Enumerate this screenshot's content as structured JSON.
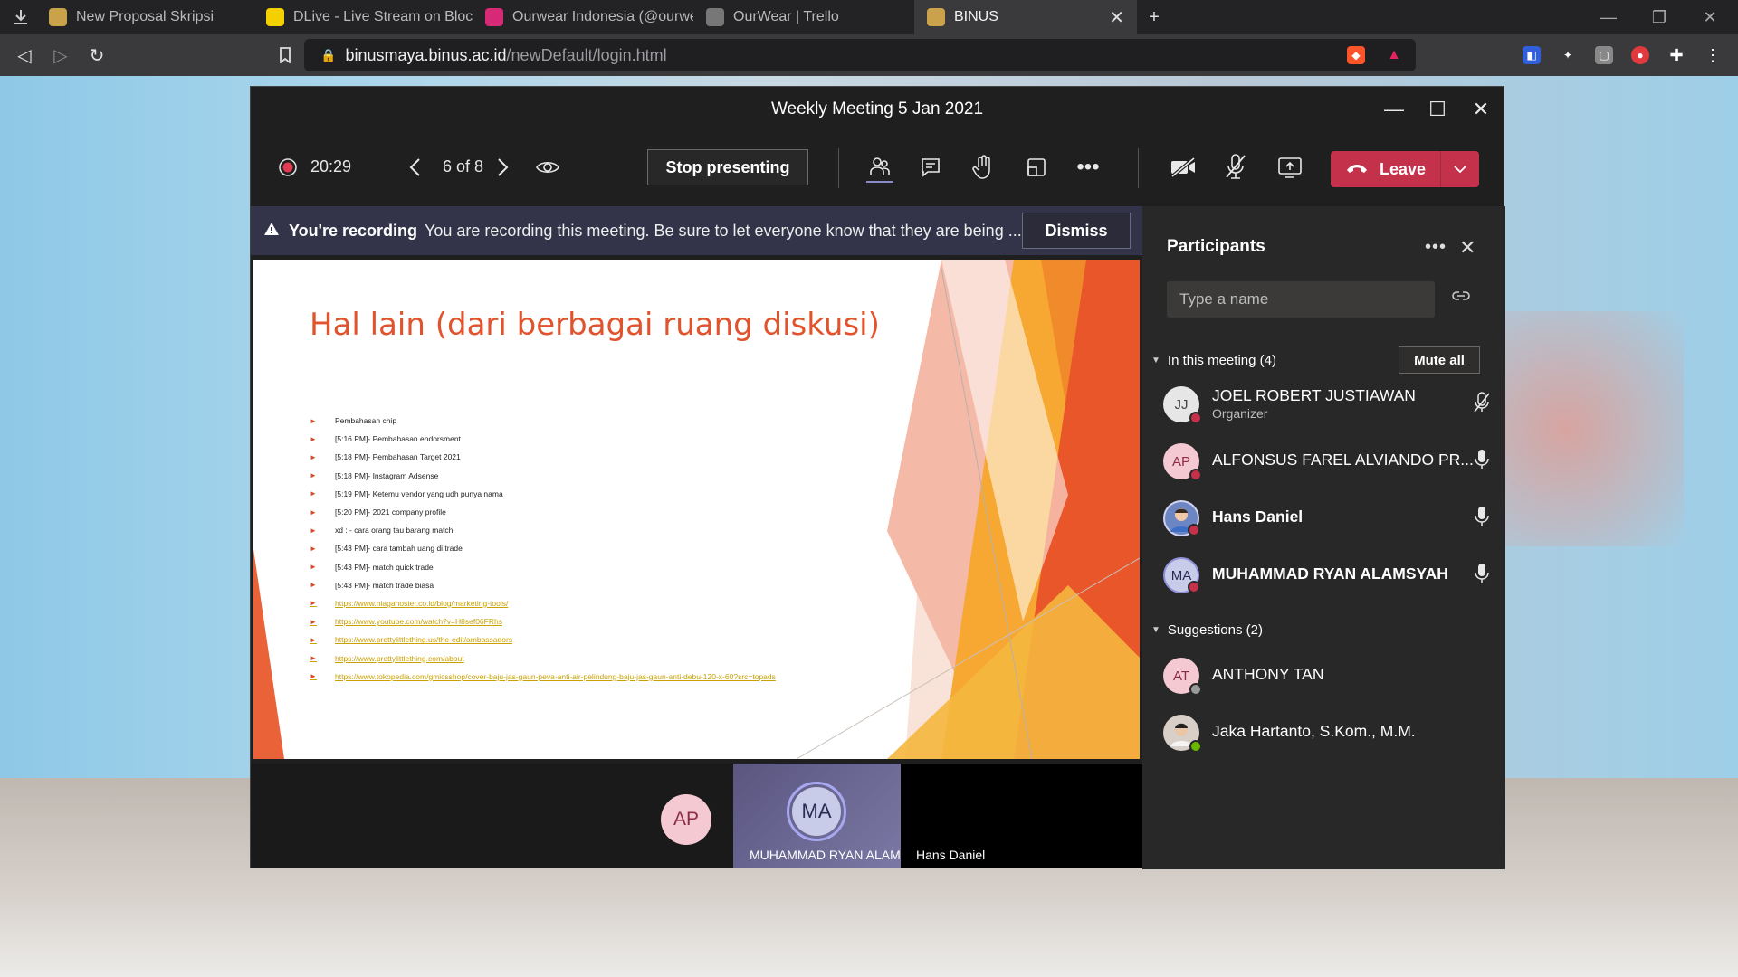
{
  "browser": {
    "tabs": [
      {
        "title": "New Proposal Skripsi",
        "color": "#c9a24b"
      },
      {
        "title": "DLive - Live Stream on Blockchain",
        "color": "#f5d000"
      },
      {
        "title": "Ourwear Indonesia (@ourwear_id) • Fo",
        "color": "#d62976"
      },
      {
        "title": "OurWear | Trello",
        "color": "#777777"
      },
      {
        "title": "BINUS",
        "color": "#c9a24b"
      }
    ],
    "url_host": "binusmaya.binus.ac.id",
    "url_path": "/newDefault/login.html"
  },
  "meeting": {
    "title": "Weekly Meeting 5 Jan 2021",
    "timer": "20:29",
    "slide_counter": "6 of 8",
    "stop_presenting_label": "Stop presenting",
    "leave_label": "Leave"
  },
  "banner": {
    "title": "You're recording",
    "message": "You are recording this meeting. Be sure to let everyone know that they are being ...",
    "dismiss_label": "Dismiss"
  },
  "slide": {
    "title": "Hal lain (dari berbagai ruang diskusi)",
    "bullets": [
      {
        "text": "Pembahasan chip",
        "link": false
      },
      {
        "text": "[5:16 PM]- Pembahasan endorsment",
        "link": false
      },
      {
        "text": "[5:18 PM]- Pembahasan Target 2021",
        "link": false
      },
      {
        "text": "[5:18 PM]- Instagram Adsense",
        "link": false
      },
      {
        "text": "[5:19 PM]- Ketemu vendor yang udh punya nama",
        "link": false
      },
      {
        "text": "[5:20 PM]- 2021 company profile",
        "link": false
      },
      {
        "text": "xd : - cara orang tau barang match",
        "link": false
      },
      {
        "text": "[5:43 PM]- cara tambah uang di trade",
        "link": false
      },
      {
        "text": "[5:43 PM]- match quick trade",
        "link": false
      },
      {
        "text": "[5:43 PM]- match trade biasa",
        "link": false
      },
      {
        "text": "https://www.niagahoster.co.id/blog/marketing-tools/",
        "link": true
      },
      {
        "text": "https://www.youtube.com/watch?v=H8sef06FRhs",
        "link": true
      },
      {
        "text": "https://www.prettylittlething.us/the-edit/ambassadors",
        "link": true
      },
      {
        "text": "https://www.prettylittlething.com/about",
        "link": true
      },
      {
        "text": "https://www.tokopedia.com/gmicsshop/cover-baju-jas-gaun-peva-anti-air-pelindung-baju-jas-gaun-anti-debu-120-x-60?src=topads",
        "link": true
      }
    ]
  },
  "strip": {
    "ap_initials": "AP",
    "ma_initials": "MA",
    "ma_name": "MUHAMMAD RYAN ALAM...",
    "hans_name": "Hans Daniel"
  },
  "participants": {
    "title": "Participants",
    "search_placeholder": "Type a name",
    "in_meeting_label": "In this meeting (4)",
    "mute_all_label": "Mute all",
    "suggestions_label": "Suggestions (2)",
    "in_meeting": [
      {
        "initials": "JJ",
        "name": "JOEL ROBERT JUSTIAWAN",
        "role": "Organizer",
        "bold": false,
        "avatar_bg": "#e6e6e6",
        "avatar_fg": "#444444",
        "dot": "#c4314b",
        "mic": "muted"
      },
      {
        "initials": "AP",
        "name": "ALFONSUS FAREL ALVIANDO PR...",
        "role": "",
        "bold": false,
        "avatar_bg": "#f4c9d2",
        "avatar_fg": "#8a2d45",
        "dot": "#c4314b",
        "mic": "on"
      },
      {
        "initials": "",
        "name": "Hans Daniel",
        "role": "",
        "bold": true,
        "avatar_bg": "#6c86c4",
        "avatar_fg": "#ffffff",
        "dot": "#c4314b",
        "mic": "on"
      },
      {
        "initials": "MA",
        "name": "MUHAMMAD RYAN ALAMSYAH",
        "role": "",
        "bold": true,
        "avatar_bg": "#c9cce8",
        "avatar_fg": "#2b2c55",
        "dot": "#c4314b",
        "mic": "on"
      }
    ],
    "suggestions": [
      {
        "initials": "AT",
        "name": "ANTHONY TAN",
        "avatar_bg": "#f4c9d2",
        "avatar_fg": "#8a2d45",
        "dot": "#9a9a9a"
      },
      {
        "initials": "",
        "name": "Jaka Hartanto, S.Kom., M.M.",
        "avatar_bg": "#d8d0c8",
        "avatar_fg": "#333333",
        "dot": "#6bb700"
      }
    ]
  }
}
